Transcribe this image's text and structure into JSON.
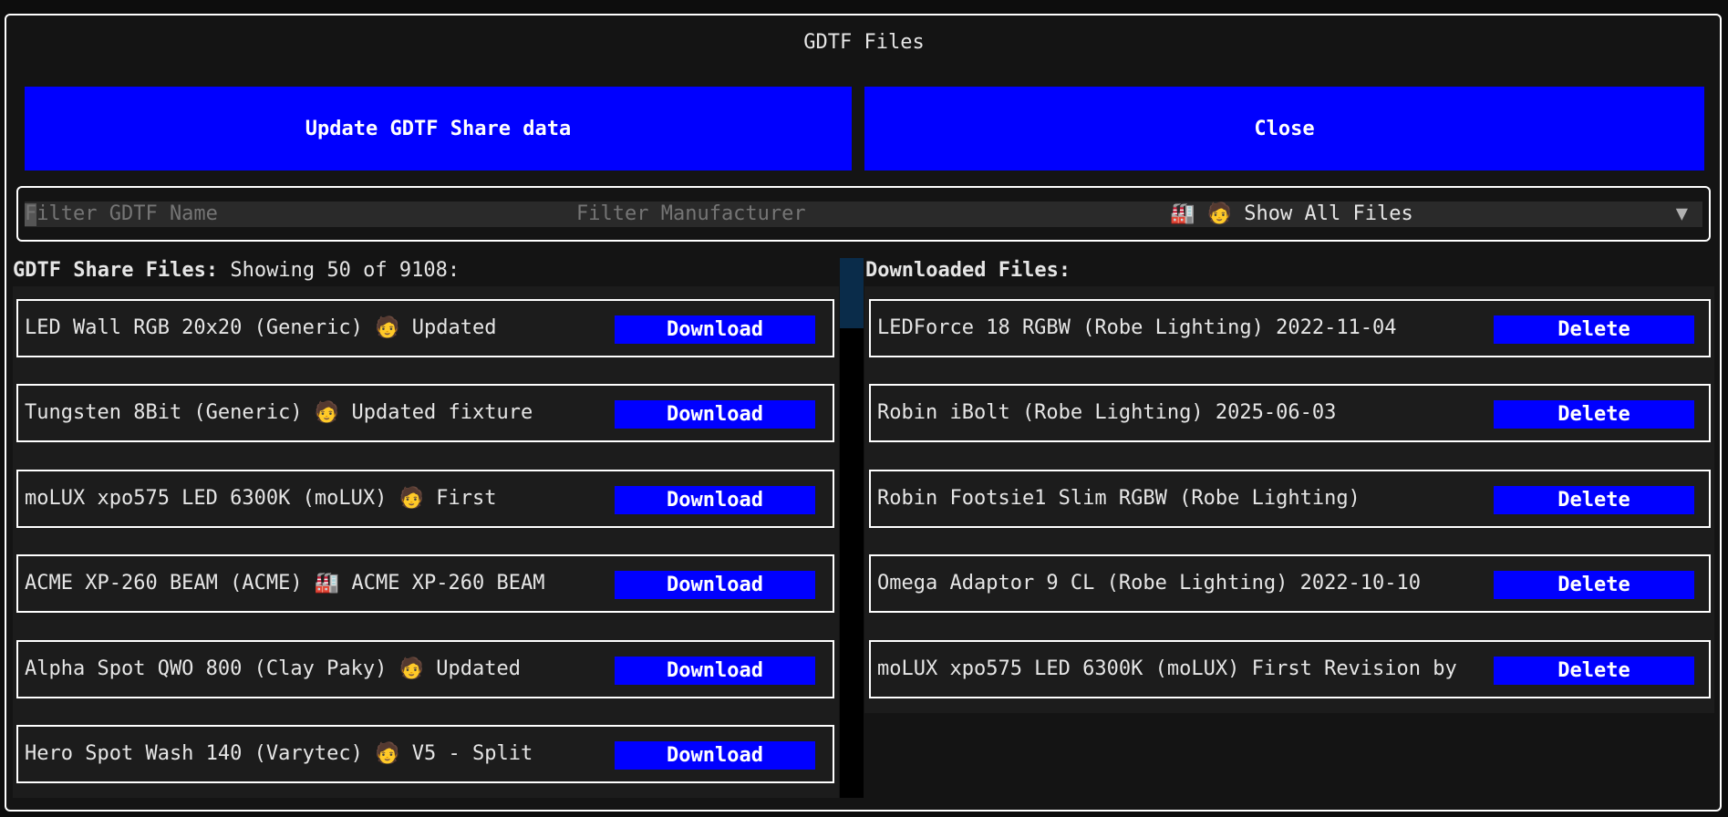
{
  "window": {
    "title": "GDTF Files"
  },
  "toolbar": {
    "update_label": "Update GDTF Share data",
    "close_label": "Close"
  },
  "filters": {
    "name_placeholder": "Filter GDTF Name",
    "manufacturer_placeholder": "Filter Manufacturer",
    "show_select_value": "🏭 🧑 Show All Files"
  },
  "share": {
    "heading": "GDTF Share Files:",
    "count_text": "Showing 50 of 9108:",
    "download_label": "Download",
    "items": [
      {
        "label": "LED Wall RGB 20x20 (Generic) 🧑 Updated"
      },
      {
        "label": "Tungsten 8Bit (Generic) 🧑 Updated fixture"
      },
      {
        "label": "moLUX xpo575 LED 6300K (moLUX) 🧑 First"
      },
      {
        "label": "ACME XP-260 BEAM (ACME) 🏭 ACME XP-260 BEAM"
      },
      {
        "label": "Alpha Spot QWO 800 (Clay Paky) 🧑 Updated"
      },
      {
        "label": "Hero Spot Wash 140 (Varytec) 🧑 V5 - Split"
      }
    ]
  },
  "downloaded": {
    "heading": "Downloaded Files:",
    "delete_label": "Delete",
    "items": [
      {
        "label": "LEDForce 18 RGBW (Robe Lighting) 2022-11-04"
      },
      {
        "label": "Robin iBolt (Robe Lighting) 2025-06-03"
      },
      {
        "label": "Robin Footsie1 Slim RGBW (Robe Lighting)"
      },
      {
        "label": "Omega Adaptor 9 CL (Robe Lighting) 2022-10-10"
      },
      {
        "label": "moLUX xpo575 LED 6300K (moLUX) First Revision by"
      }
    ]
  },
  "colors": {
    "accent": "#0000ff",
    "border": "#ffffff",
    "background": "#141414",
    "panel": "#1c1c1c"
  }
}
